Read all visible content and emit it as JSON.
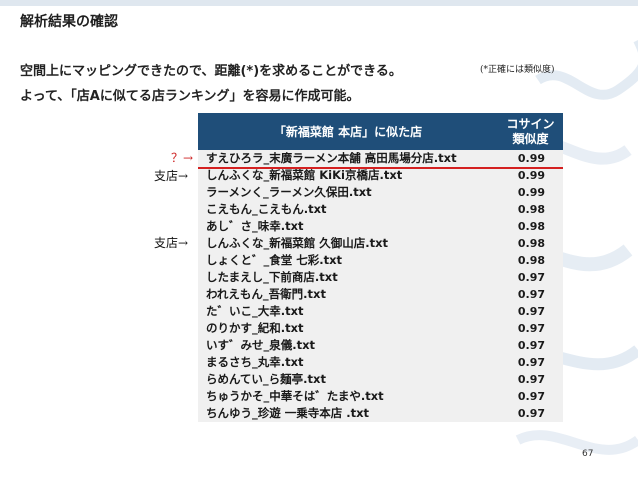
{
  "slide": {
    "title": "解析結果の確認",
    "line1": "空間上にマッピングできたので、距離(*)を求めることができる。",
    "line2": "よって、「店Aに似てる店ランキング」を容易に作成可能。",
    "note": "(*正確には類似度)",
    "page_number": "67"
  },
  "table": {
    "header_store": "「新福菜館 本店」に似た店",
    "header_sim_1": "コサイン",
    "header_sim_2": "類似度",
    "rows": [
      {
        "name": "すえひろラ_末廣ラーメン本舗 高田馬場分店.txt",
        "score": "0.99"
      },
      {
        "name": "しんふくな_新福菜館 KiKi京橋店.txt",
        "score": "0.99"
      },
      {
        "name": "ラーメンく_ラーメン久保田.txt",
        "score": "0.99"
      },
      {
        "name": "こえもん_こえもん.txt",
        "score": "0.98"
      },
      {
        "name": "あし゛さ_味幸.txt",
        "score": "0.98"
      },
      {
        "name": "しんふくな_新福菜館 久御山店.txt",
        "score": "0.98"
      },
      {
        "name": "しょくと゛_食堂 七彩.txt",
        "score": "0.98"
      },
      {
        "name": "したまえし_下前商店.txt",
        "score": "0.97"
      },
      {
        "name": "われえもん_吾衛門.txt",
        "score": "0.97"
      },
      {
        "name": "た゛いこ_大幸.txt",
        "score": "0.97"
      },
      {
        "name": "のりかす_紀和.txt",
        "score": "0.97"
      },
      {
        "name": "いす゛みせ_泉儀.txt",
        "score": "0.97"
      },
      {
        "name": "まるさち_丸幸.txt",
        "score": "0.97"
      },
      {
        "name": "らめんてい_ら麺亭.txt",
        "score": "0.97"
      },
      {
        "name": "ちゅうかそ_中華そは゛たまや.txt",
        "score": "0.97"
      },
      {
        "name": "ちんゆう_珍遊 一乗寺本店 .txt",
        "score": "0.97"
      }
    ]
  },
  "markers": {
    "question": "？→",
    "branch_1": "支店→",
    "branch_2": "支店→"
  }
}
